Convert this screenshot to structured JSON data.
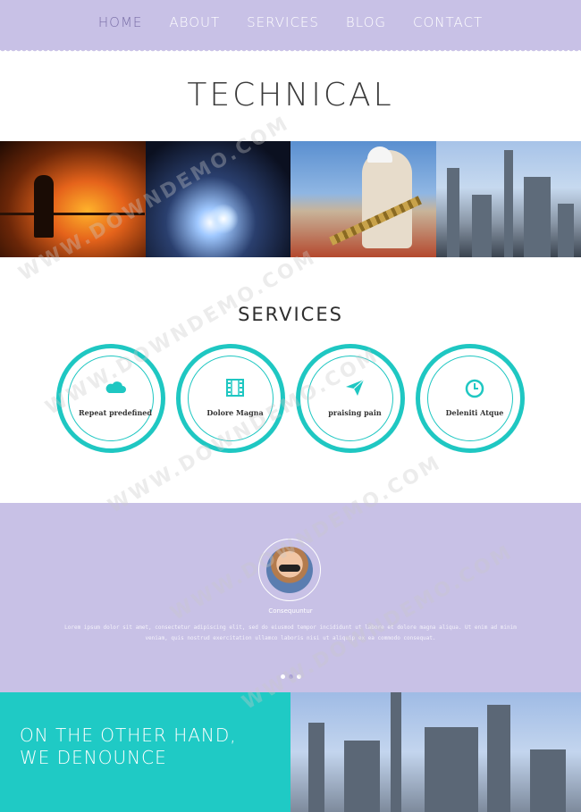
{
  "nav": {
    "items": [
      {
        "label": "HOME",
        "active": true
      },
      {
        "label": "ABOUT"
      },
      {
        "label": "SERVICES"
      },
      {
        "label": "BLOG"
      },
      {
        "label": "CONTACT"
      }
    ]
  },
  "hero": {
    "title": "TECHNICAL"
  },
  "photos": [
    "steel-furnace-photo",
    "welding-sparks-photo",
    "worker-chain-photo",
    "refinery-photo"
  ],
  "services": {
    "title": "SERVICES",
    "items": [
      {
        "label": "Repeat predefined",
        "icon": "cloud-icon"
      },
      {
        "label": "Dolore Magna",
        "icon": "film-icon"
      },
      {
        "label": "praising pain",
        "icon": "paper-plane-icon"
      },
      {
        "label": "Deleniti Atque",
        "icon": "clock-icon"
      }
    ]
  },
  "testimonial": {
    "name": "Consequuntur",
    "text": "Lorem ipsum dolor sit amet, consectetur adipiscing elit, sed do eiusmod tempor incididunt ut labore et dolore magna aliqua. Ut enim ad minim veniam, quis nostrud exercitation ullamco laboris nisi ut aliquip ex ea commodo consequat."
  },
  "bottom": {
    "heading_line1": "ON THE OTHER HAND,",
    "heading_line2": "WE DENOUNCE"
  },
  "colors": {
    "lavender": "#c8c1e6",
    "teal": "#1fc7c2"
  },
  "watermark": "WWW.DOWNDEMO.COM"
}
